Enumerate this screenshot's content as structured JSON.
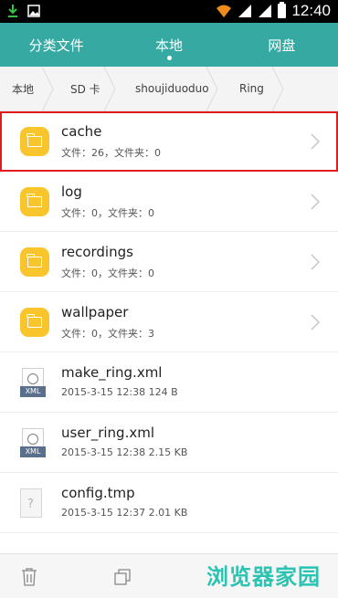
{
  "status_bar": {
    "time": "12:40"
  },
  "tabs": [
    {
      "label": "分类文件"
    },
    {
      "label": "本地"
    },
    {
      "label": "网盘"
    }
  ],
  "breadcrumb": [
    {
      "label": "本地"
    },
    {
      "label": "SD 卡"
    },
    {
      "label": "shoujiduoduo"
    },
    {
      "label": "Ring"
    }
  ],
  "files": [
    {
      "name": "cache",
      "info": "文件：26，文件夹：0",
      "type": "folder"
    },
    {
      "name": "log",
      "info": "文件：0，文件夹：0",
      "type": "folder"
    },
    {
      "name": "recordings",
      "info": "文件：0，文件夹：0",
      "type": "folder"
    },
    {
      "name": "wallpaper",
      "info": "文件：0，文件夹：3",
      "type": "folder"
    },
    {
      "name": "make_ring.xml",
      "info": "2015-3-15 12:38 124 B",
      "type": "xml"
    },
    {
      "name": "user_ring.xml",
      "info": "2015-3-15 12:38 2.15 KB",
      "type": "xml"
    },
    {
      "name": "config.tmp",
      "info": "2015-3-15 12:37 2.01 KB",
      "type": "tmp"
    }
  ],
  "icons": {
    "xml_tag": "XML",
    "tmp_glyph": "?"
  },
  "watermark": "浏览器家园",
  "colors": {
    "accent": "#36a9a2",
    "folder": "#f8c62c",
    "selection": "#e21c1c"
  }
}
